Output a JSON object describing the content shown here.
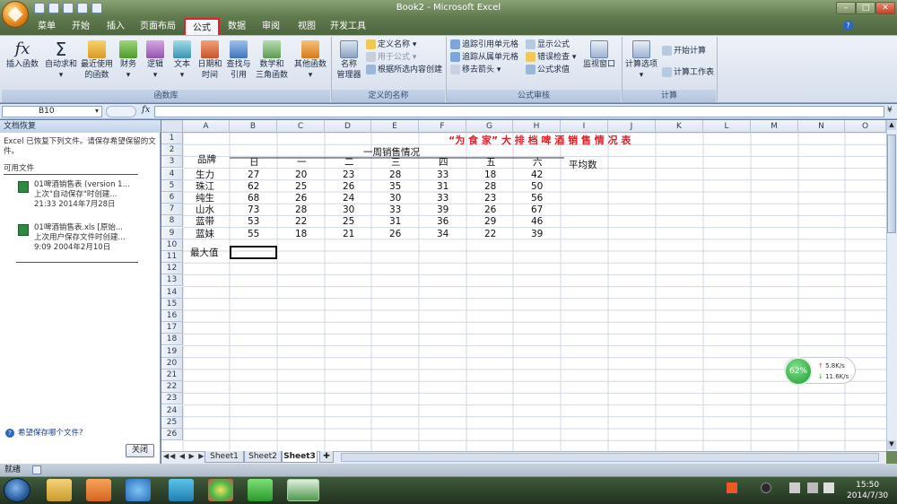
{
  "window": {
    "title": "Book2 - Microsoft Excel"
  },
  "menu": [
    "菜单",
    "开始",
    "插入",
    "页面布局",
    "公式",
    "数据",
    "审阅",
    "视图",
    "开发工具"
  ],
  "ribbon": {
    "lib": {
      "insert_fn": "插入函数",
      "autosum": "自动求和",
      "recent1": "最近使用",
      "recent2": "的函数",
      "finance": "财务",
      "logic": "逻辑",
      "text": "文本",
      "date1": "日期和",
      "date2": "时间",
      "lookup1": "查找与",
      "lookup2": "引用",
      "math1": "数学和",
      "math2": "三角函数",
      "other": "其他函数",
      "label": "函数库"
    },
    "names": {
      "manager1": "名称",
      "manager2": "管理器",
      "define": "定义名称",
      "use": "用于公式",
      "create": "根据所选内容创建",
      "label": "定义的名称"
    },
    "audit": {
      "trace_prec": "追踪引用单元格",
      "trace_dep": "追踪从属单元格",
      "remove": "移去箭头",
      "show": "显示公式",
      "check": "错误检查",
      "eval": "公式求值",
      "watch": "监视窗口",
      "label": "公式审核"
    },
    "calc": {
      "options": "计算选项",
      "calc_now": "开始计算",
      "calc_sheet": "计算工作表",
      "label": "计算"
    }
  },
  "formula_bar": {
    "name_box": "B10",
    "fx": "fx",
    "content": ""
  },
  "recovery": {
    "title": "文档恢复",
    "desc": "Excel 已恢复下列文件。请保存希望保留的文件。",
    "available": "可用文件",
    "files": [
      {
        "name": "01啤酒销售表 (version 1...",
        "note": "上次\"自动保存\"时创建...",
        "time": "21:33 2014年7月28日"
      },
      {
        "name": "01啤酒销售表.xls [原始...",
        "note": "上次用户保存文件时创建...",
        "time": "9:09 2004年2月10日"
      }
    ],
    "help": "希望保存哪个文件?",
    "close": "关闭"
  },
  "columns": [
    "A",
    "B",
    "C",
    "D",
    "E",
    "F",
    "G",
    "H",
    "I",
    "J",
    "K",
    "L",
    "M",
    "N",
    "O"
  ],
  "sheet": {
    "title": "“为 食 家” 大 排 档 啤 酒 销 售 情 况 表",
    "week": "一周销售情况",
    "brand": "品牌",
    "days": [
      "日",
      "一",
      "二",
      "三",
      "四",
      "五",
      "六"
    ],
    "avg": "平均数",
    "rows": [
      {
        "name": "生力",
        "v": [
          27,
          20,
          23,
          28,
          33,
          18,
          42
        ]
      },
      {
        "name": "珠江",
        "v": [
          62,
          25,
          26,
          35,
          31,
          28,
          50
        ]
      },
      {
        "name": "纯生",
        "v": [
          68,
          26,
          24,
          30,
          33,
          23,
          56
        ]
      },
      {
        "name": "山水",
        "v": [
          73,
          28,
          30,
          33,
          39,
          26,
          67
        ]
      },
      {
        "name": "蓝带",
        "v": [
          53,
          22,
          25,
          31,
          36,
          29,
          46
        ]
      },
      {
        "name": "蓝妹",
        "v": [
          55,
          18,
          21,
          26,
          34,
          22,
          39
        ]
      }
    ],
    "max": "最大值"
  },
  "tabs": [
    "Sheet1",
    "Sheet2",
    "Sheet3"
  ],
  "status": "就绪",
  "speed": {
    "pct": "62%",
    "up": "5.8K/s",
    "down": "11.6K/s"
  },
  "clock": {
    "time": "15:50",
    "date": "2014/7/30"
  }
}
